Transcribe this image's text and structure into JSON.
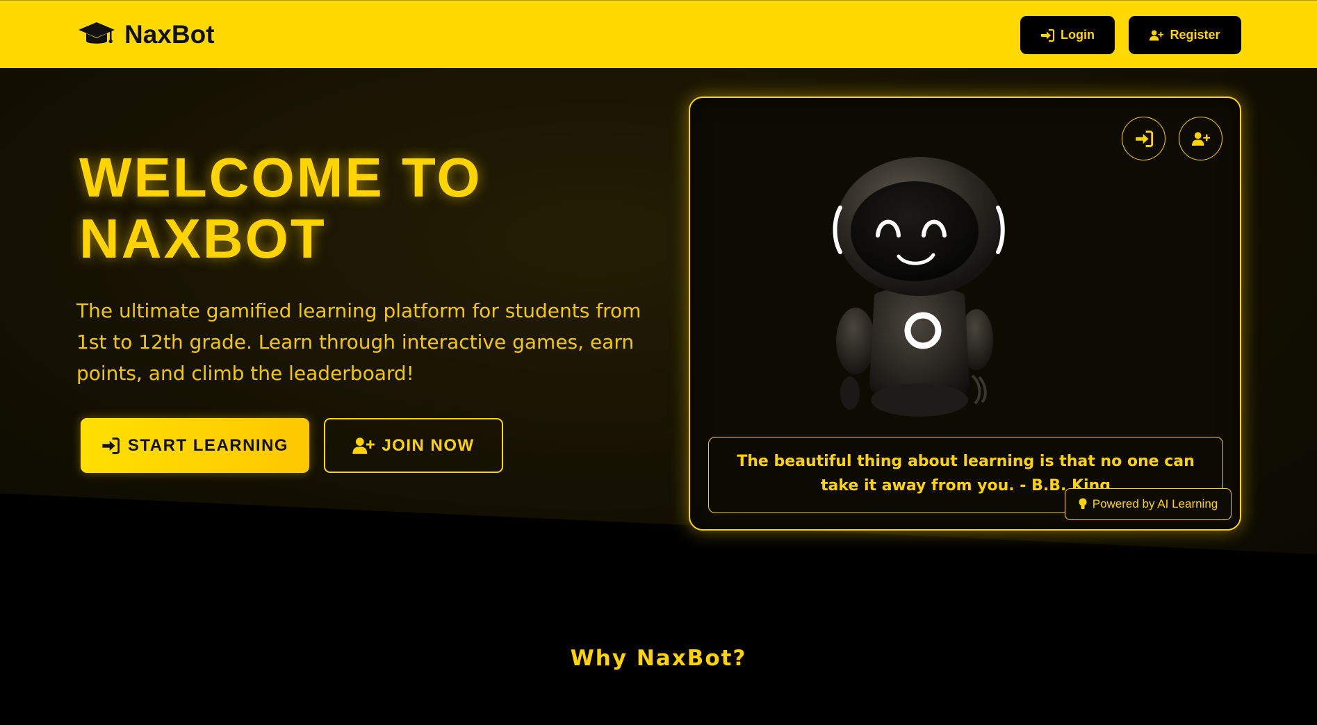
{
  "navbar": {
    "brand": "NaxBot",
    "login_label": "Login",
    "register_label": "Register"
  },
  "hero": {
    "title_line1": "WELCOME TO",
    "title_line2": "NAXBOT",
    "subtitle": "The ultimate gamified learning platform for students from 1st to 12th grade. Learn through interactive games, earn points, and climb the leaderboard!",
    "start_label": "START LEARNING",
    "join_label": "JOIN NOW"
  },
  "card": {
    "quote": "The beautiful thing about learning is that no one can take it away from you. - B.B. King",
    "powered_label": "Powered by AI Learning"
  },
  "section": {
    "why_title": "Why NaxBot?"
  },
  "icons": {
    "brand": "graduation-cap-icon",
    "login": "sign-in-icon",
    "register": "user-plus-icon",
    "powered": "lightbulb-icon"
  },
  "colors": {
    "accent": "#ffd400",
    "navbar_bg": "#ffd900",
    "page_bg": "#000000"
  }
}
